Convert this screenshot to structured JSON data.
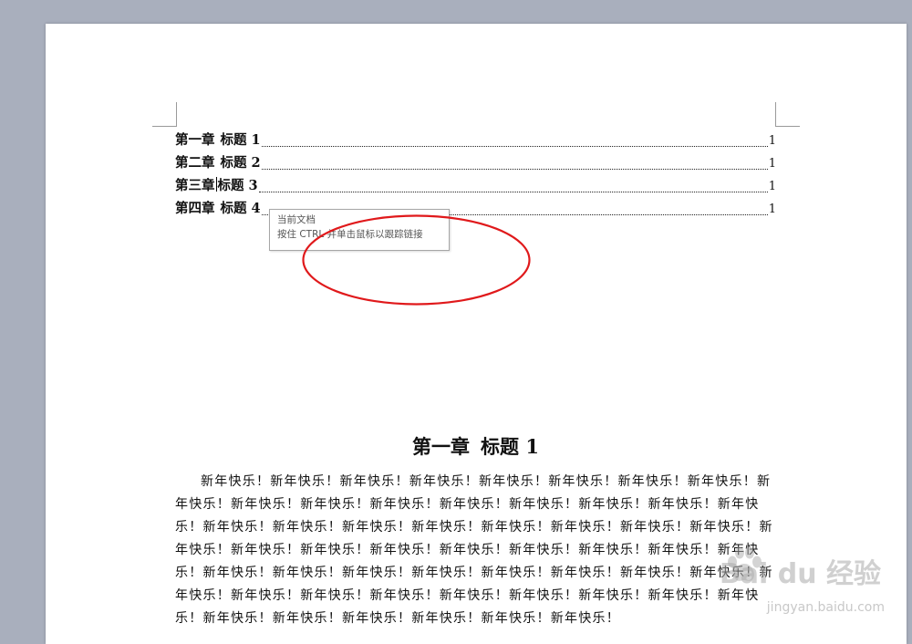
{
  "toc": [
    {
      "chapter": "第一章",
      "title": "标题 1",
      "page": "1"
    },
    {
      "chapter": "第二章",
      "title": "标题 2",
      "page": "1"
    },
    {
      "chapter": "第三章",
      "title": "标题 3",
      "page": "1"
    },
    {
      "chapter": "第四章",
      "title": "标题 4",
      "page": "1"
    }
  ],
  "tooltip": {
    "line1": "当前文档",
    "line2": "按住 CTRL 并单击鼠标以跟踪链接"
  },
  "heading": {
    "chapter": "第一章",
    "title": "标题 1"
  },
  "body_text": "新年快乐！新年快乐！新年快乐！新年快乐！新年快乐！新年快乐！新年快乐！新年快乐！新年快乐！新年快乐！新年快乐！新年快乐！新年快乐！新年快乐！新年快乐！新年快乐！新年快乐！新年快乐！新年快乐！新年快乐！新年快乐！新年快乐！新年快乐！新年快乐！新年快乐！新年快乐！新年快乐！新年快乐！新年快乐！新年快乐！新年快乐！新年快乐！新年快乐！新年快乐！新年快乐！新年快乐！新年快乐！新年快乐！新年快乐！新年快乐！新年快乐！新年快乐！新年快乐！新年快乐！新年快乐！新年快乐！新年快乐！新年快乐！新年快乐！新年快乐！新年快乐！新年快乐！新年快乐！新年快乐！新年快乐！新年快乐！新年快乐！",
  "watermark": {
    "brand": "Bai du 经验",
    "url": "jingyan.baidu.com"
  },
  "colors": {
    "annotation": "#e0191b",
    "workspace": "#a9afbd"
  }
}
